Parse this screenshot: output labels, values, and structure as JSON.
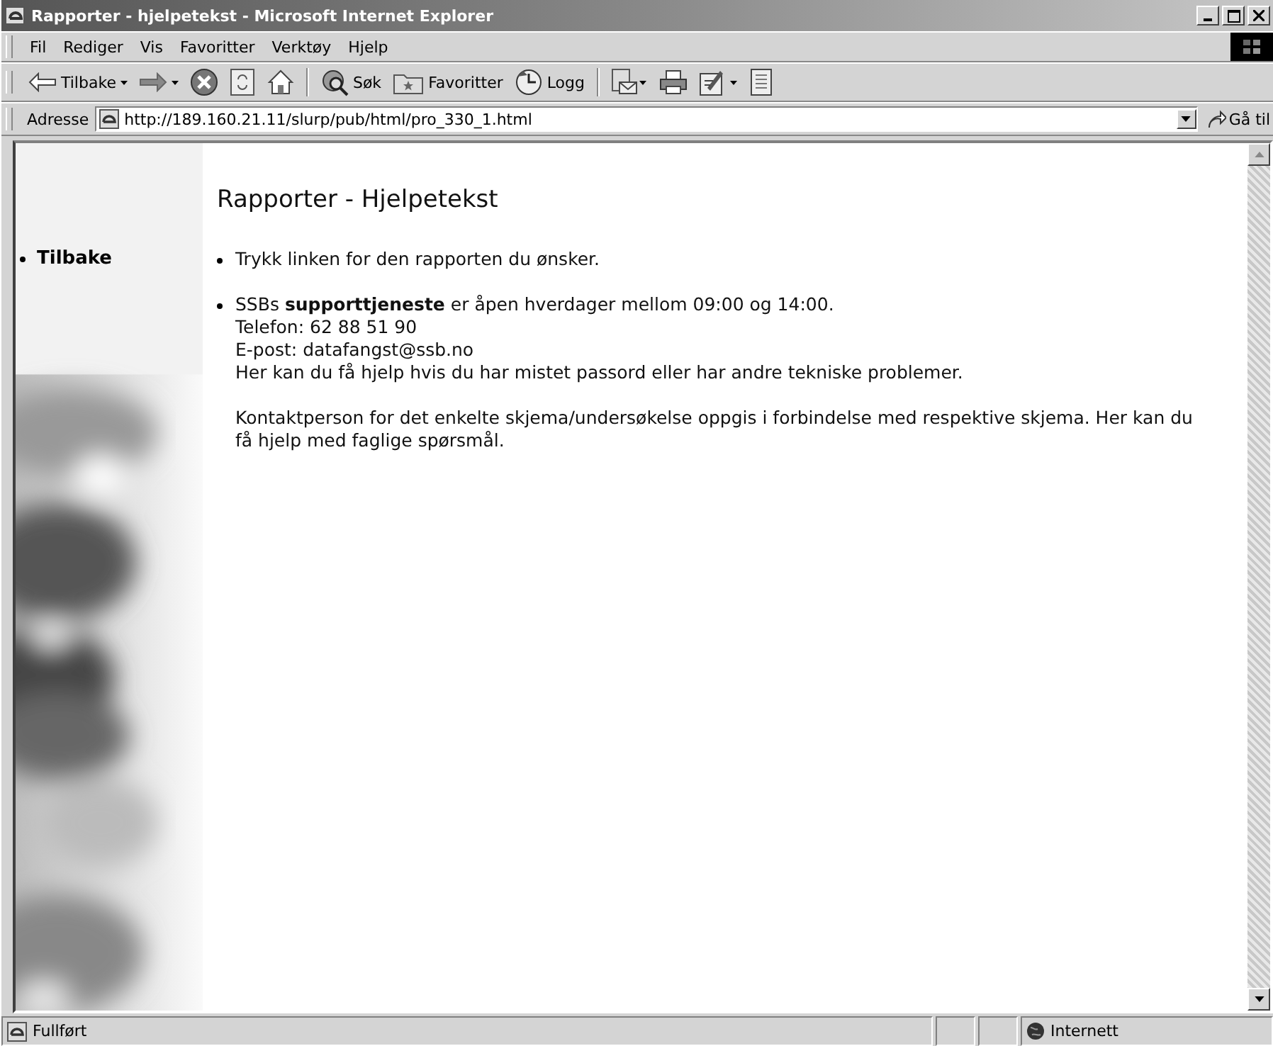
{
  "window": {
    "title": "Rapporter - hjelpetekst - Microsoft Internet Explorer"
  },
  "menu": [
    "Fil",
    "Rediger",
    "Vis",
    "Favoritter",
    "Verktøy",
    "Hjelp"
  ],
  "toolbar": [
    {
      "kind": "back",
      "label": "Tilbake"
    },
    {
      "kind": "forward"
    },
    {
      "kind": "stop"
    },
    {
      "kind": "refresh"
    },
    {
      "kind": "home"
    },
    {
      "kind": "separator"
    },
    {
      "kind": "search",
      "label": "Søk"
    },
    {
      "kind": "favorites",
      "label": "Favoritter"
    },
    {
      "kind": "history",
      "label": "Logg"
    },
    {
      "kind": "separator"
    },
    {
      "kind": "mail"
    },
    {
      "kind": "print"
    },
    {
      "kind": "edit"
    },
    {
      "kind": "discuss"
    }
  ],
  "address": {
    "label": "Adresse",
    "value": "http://189.160.21.11/slurp/pub/html/pro_330_1.html",
    "go": "Gå til"
  },
  "sidebar": {
    "kind": "picture",
    "links": [
      "Tilbake"
    ]
  },
  "page": {
    "heading": "Rapporter - Hjelpetekst",
    "items": [
      {
        "lines": [
          "Trykk linken for den rapporten du ønsker."
        ]
      },
      {
        "lines": [
          "SSBs **supporttjeneste** er åpen hverdager mellom 09:00 og 14:00.",
          "Telefon: 62 88 51 90",
          "E-post: datafangst@ssb.no",
          "Her kan du få hjelp hvis du har mistet passord eller har andre tekniske problemer."
        ],
        "paragraph": "Kontaktperson for det enkelte skjema/undersøkelse oppgis i forbindelse med respektive skjema. Her kan du få hjelp med faglige spørsmål."
      }
    ]
  },
  "status_bar": {
    "text": "Fullført",
    "zone": "Internett"
  }
}
